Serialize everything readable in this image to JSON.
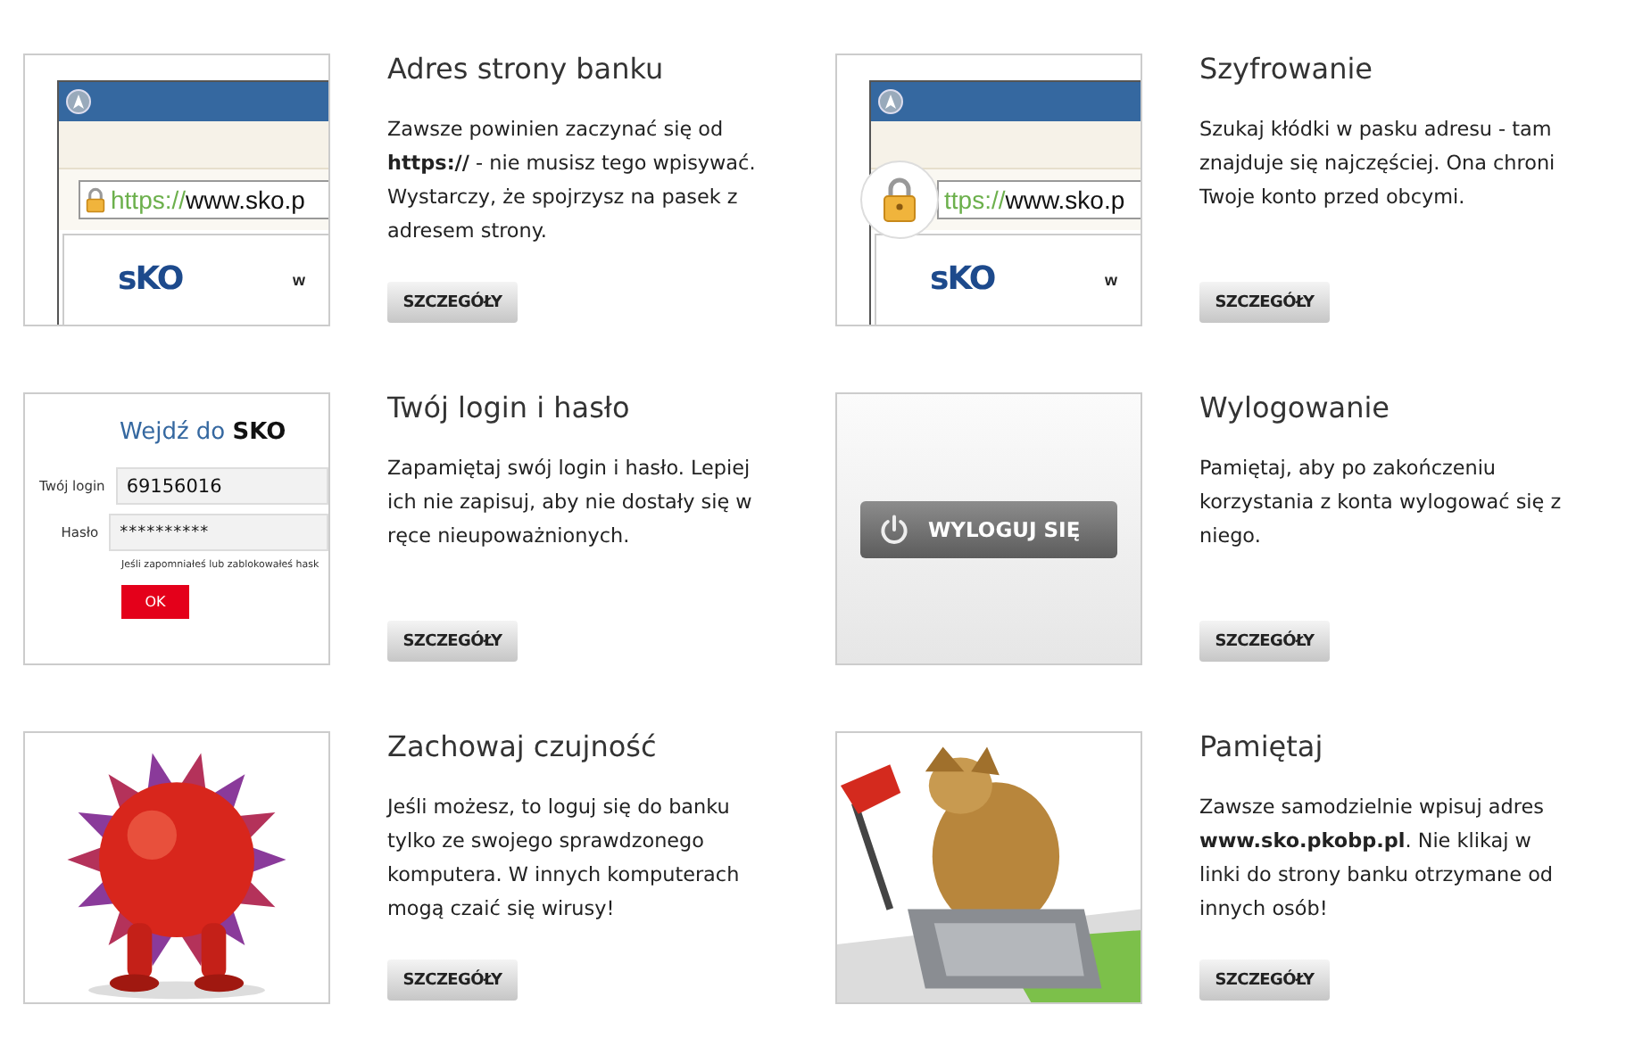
{
  "cards": [
    {
      "title": "Adres strony banku",
      "body": "Zawsze powinien zaczynać się od **https://** - nie musisz tego wpisywać. Wystarczy, że spojrzysz na pasek z adresem strony.",
      "button": "SZCZEGÓŁY",
      "thumb": {
        "kind": "browser",
        "url_scheme": "https://",
        "url_rest": "www.sko.p",
        "logo": "sKO",
        "side_text": "w",
        "lock_circled": false
      }
    },
    {
      "title": "Szyfrowanie",
      "body": "Szukaj kłódki w pasku adresu - tam znajduje się najczęściej. Ona chroni Twoje konto przed obcymi.",
      "button": "SZCZEGÓŁY",
      "thumb": {
        "kind": "browser",
        "url_scheme": "ttps://",
        "url_rest": "www.sko.p",
        "logo": "sKO",
        "side_text": "w",
        "lock_circled": true
      }
    },
    {
      "title": "Twój login i hasło",
      "body": "Zapamiętaj swój login i hasło. Lepiej ich nie zapisuj, aby nie dostały się w ręce nieupoważnionych.",
      "button": "SZCZEGÓŁY",
      "thumb": {
        "kind": "login",
        "heading": "Wejdź do **SKO**",
        "login_label": "Twój login",
        "login_value": "69156016",
        "password_label": "Hasło",
        "password_value": "**********",
        "note": "Jeśli zapomniałeś lub zablokowałeś hask",
        "submit": "OK"
      }
    },
    {
      "title": "Wylogowanie",
      "body": "Pamiętaj, aby po zakończeniu korzystania z konta wylogować się z niego.",
      "button": "SZCZEGÓŁY",
      "thumb": {
        "kind": "logout",
        "label": "WYLOGUJ SIĘ"
      }
    },
    {
      "title": "Zachowaj czujność",
      "body": "Jeśli możesz, to loguj się do banku tylko ze swojego sprawdzonego komputera. W innych komputerach mogą czaić się wirusy!",
      "button": "SZCZEGÓŁY"
    },
    {
      "title": "Pamiętaj",
      "body": "Zawsze samodzielnie wpisuj adres **www.sko.pkobp.pl**. Nie klikaj w linki do strony banku otrzymane od innych osób!",
      "button": "SZCZEGÓŁY"
    }
  ]
}
